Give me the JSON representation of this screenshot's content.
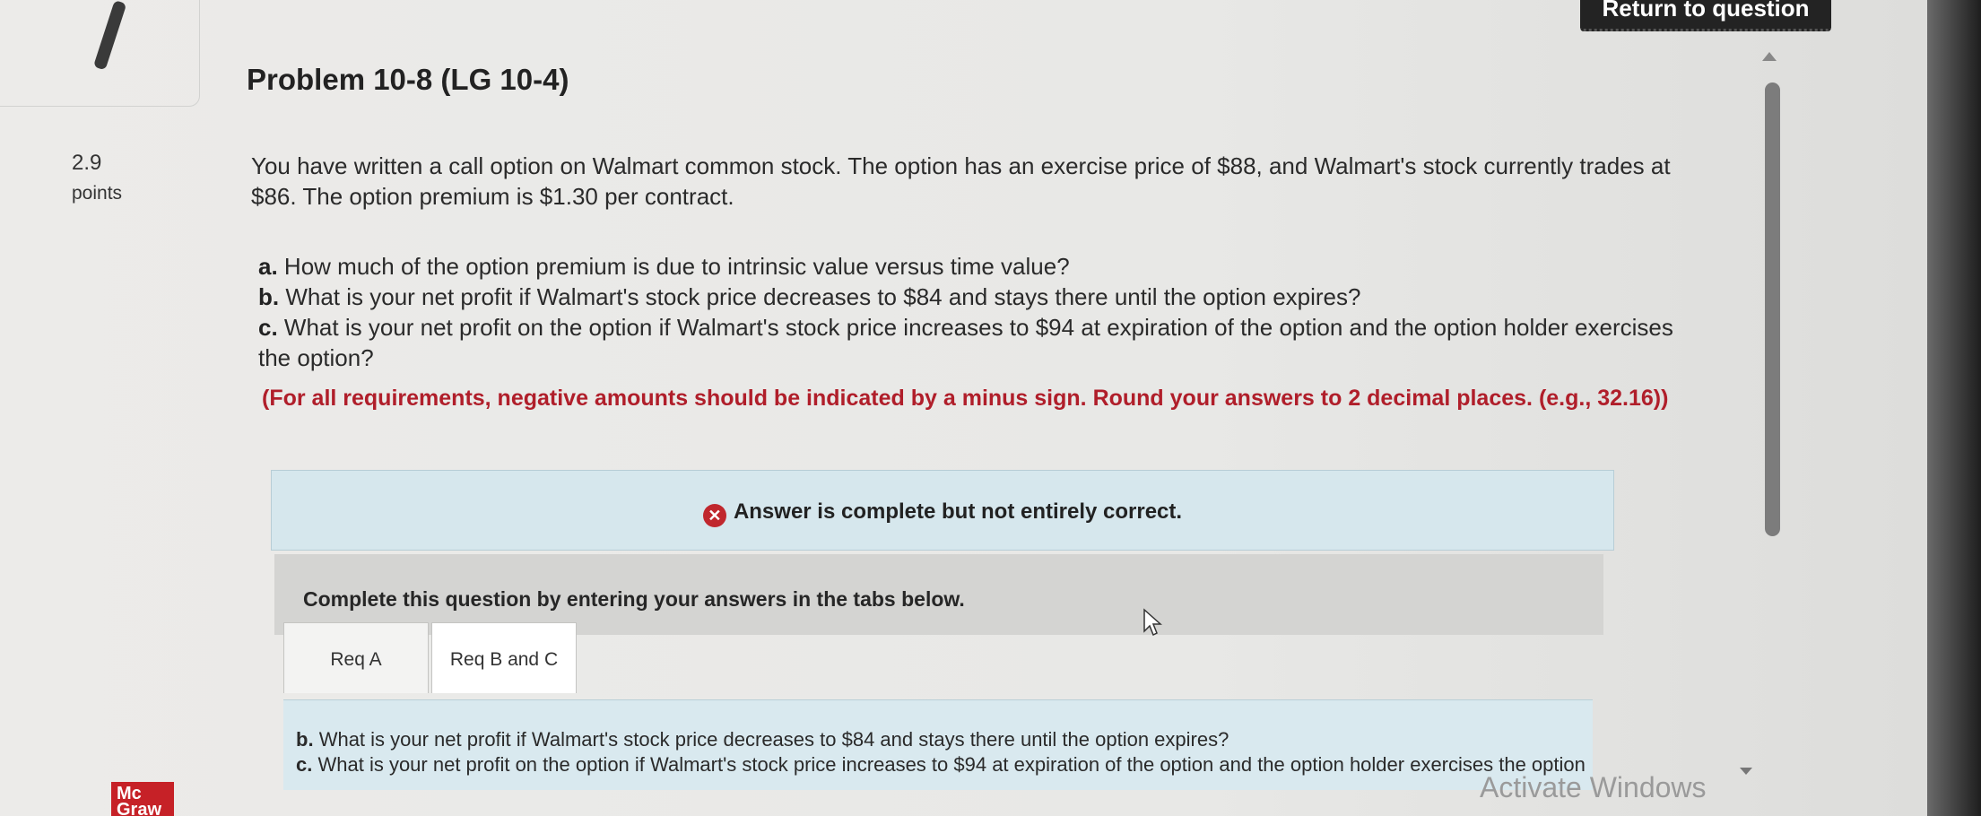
{
  "header": {
    "return_label": "Return to question"
  },
  "problem": {
    "title": "Problem 10-8 (LG 10-4)",
    "points_value": "2.9",
    "points_label": "points",
    "question": "You have written a call option on Walmart common stock. The option has an exercise price of $88, and Walmart's stock currently trades at $86. The option premium is $1.30 per contract.",
    "parts": [
      {
        "letter": "a.",
        "text": "How much of the option premium is due to intrinsic value versus time value?"
      },
      {
        "letter": "b.",
        "text": "What is your net profit if Walmart's stock price decreases to $84 and stays there until the option expires?"
      },
      {
        "letter": "c.",
        "text": "What is your net profit on the option if Walmart's stock price increases to $94 at expiration of the option and the option holder exercises the option?"
      }
    ],
    "instruction": "(For all requirements, negative amounts should be indicated by a minus sign. Round your answers to 2 decimal places. (e.g., 32.16))"
  },
  "feedback": {
    "icon": "x-circle-icon",
    "status_text": "Answer is complete but not entirely correct.",
    "status_color": "#c0272d"
  },
  "tabs_section": {
    "prompt": "Complete this question by entering your answers in the tabs below.",
    "tabs": [
      {
        "label": "Req A"
      },
      {
        "label": "Req B and C"
      }
    ],
    "active_content": [
      {
        "letter": "b.",
        "text": "What is your net profit if Walmart's stock price decreases to $84 and stays there until the option expires?"
      },
      {
        "letter": "c.",
        "text": "What is your net profit on the option if Walmart's stock price increases to $94 at expiration of the option and the option holder exercises the option"
      }
    ]
  },
  "overlay": {
    "watermark": "Activate Windows"
  },
  "branding": {
    "logo_text_1": "Mc",
    "logo_text_2": "Graw",
    "brand_color": "#c62127"
  }
}
